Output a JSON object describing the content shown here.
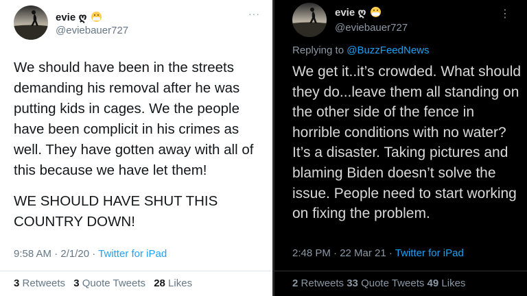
{
  "left_tweet": {
    "name": "evie ღ",
    "handle": "@eviebauer727",
    "more": "···",
    "paragraph1": "We should have been in the streets demanding his removal after he was putting kids in cages. We the people have been complicit in his crimes as well. They have gotten away with all of this because we have let them!",
    "paragraph2": "WE SHOULD HAVE SHUT THIS COUNTRY DOWN!",
    "time": "9:58 AM · 2/1/20 · ",
    "source": "Twitter for iPad",
    "retweets_count": "3",
    "retweets_label": "Retweets",
    "quotes_count": "3",
    "quotes_label": "Quote Tweets",
    "likes_count": "28",
    "likes_label": "Likes"
  },
  "right_tweet": {
    "name": "evie ღ",
    "handle": "@eviebauer727",
    "more": "⋮",
    "replying_prefix": "Replying to ",
    "replying_to": "@BuzzFeedNews",
    "body": "We get it..it’s crowded. What should they do...leave them all standing on the other side of the fence in horrible conditions with no water? It’s a disaster. Taking pictures and blaming Biden doesn’t solve the issue. People need to start working on fixing the problem.",
    "time": "2:48 PM · 22 Mar 21 · ",
    "source": "Twitter for iPad",
    "retweets_count": "2",
    "retweets_label": "Retweets",
    "quotes_count": "33",
    "quotes_label": "Quote Tweets",
    "likes_count": "49",
    "likes_label": "Likes"
  },
  "colors": {
    "link": "#1da1f2",
    "light_bg": "#ffffff",
    "dark_bg": "#000000"
  }
}
